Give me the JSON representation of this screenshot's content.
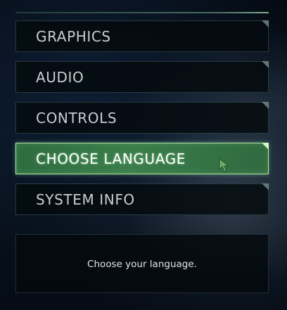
{
  "menu": {
    "items": [
      {
        "label": "GRAPHICS"
      },
      {
        "label": "AUDIO"
      },
      {
        "label": "CONTROLS"
      },
      {
        "label": "CHOOSE LANGUAGE"
      },
      {
        "label": "SYSTEM INFO"
      }
    ],
    "selected": "CHOOSE LANGUAGE"
  },
  "description": {
    "text": "Choose your language."
  },
  "colors": {
    "selected_fill": "#3b7d4b",
    "selected_border": "#b6e6ad",
    "item_text": "#c7ced2"
  },
  "icons": {
    "cursor": "green-arrow-cursor-icon"
  }
}
